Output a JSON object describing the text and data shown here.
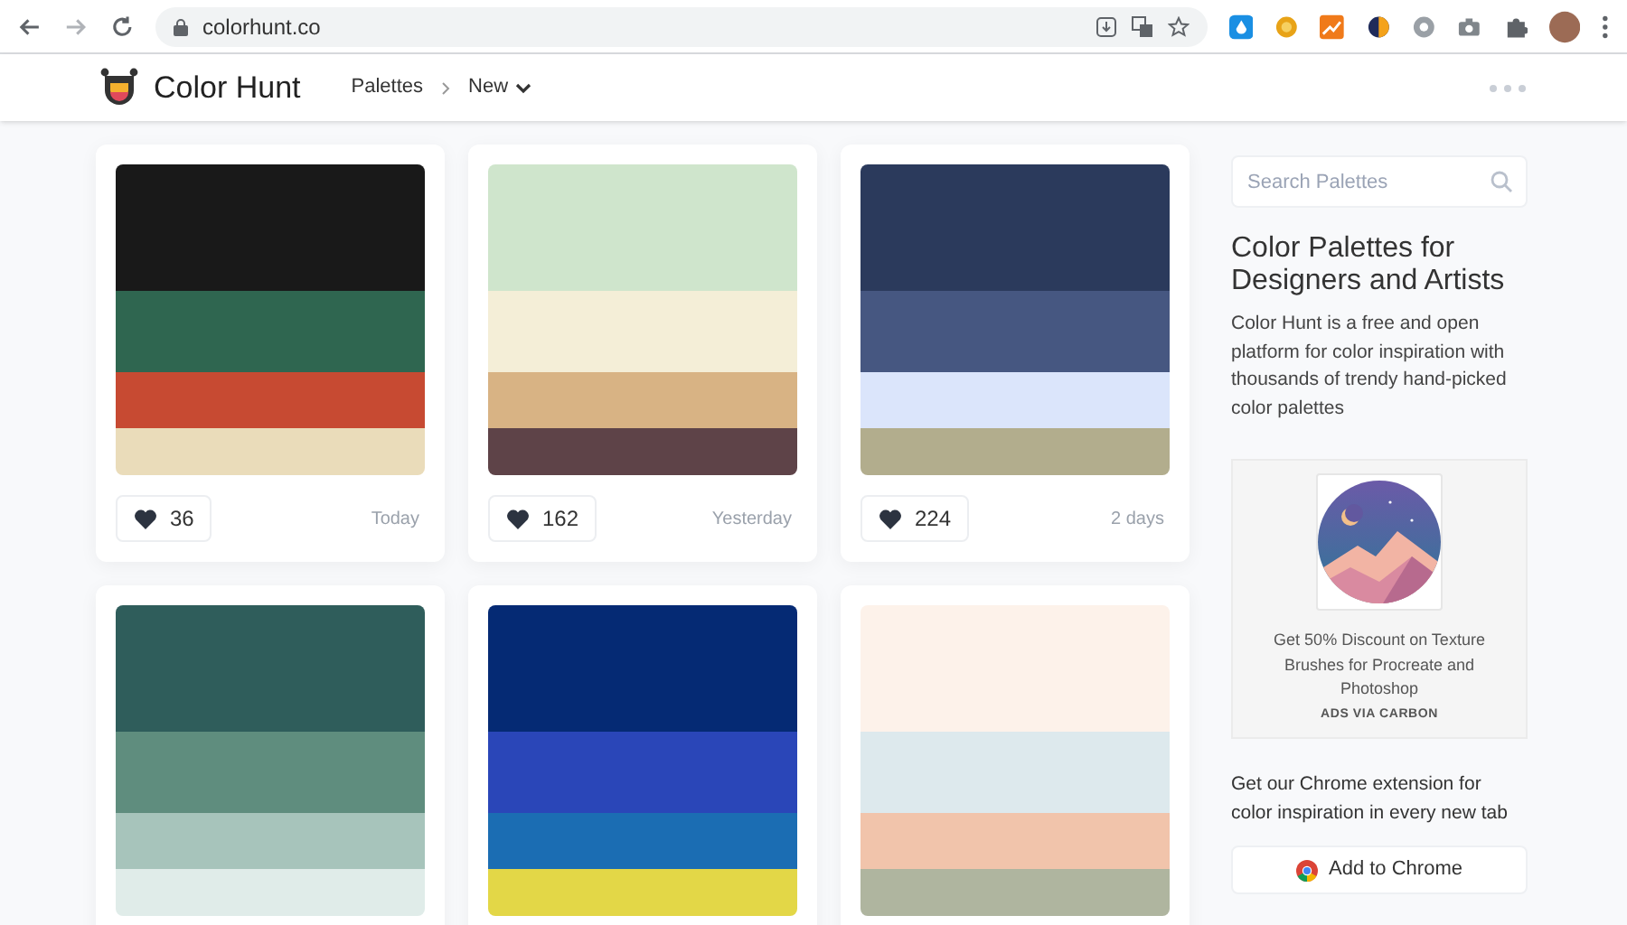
{
  "browser": {
    "url": "colorhunt.co"
  },
  "site": {
    "name": "Color Hunt",
    "nav": [
      {
        "label": "Palettes",
        "kind": "link"
      },
      {
        "label": "New",
        "kind": "dropdown"
      }
    ]
  },
  "palettes": [
    {
      "swatches": [
        {
          "color": "#191919"
        },
        {
          "color": "#2f6650"
        },
        {
          "color": "#c74a32"
        },
        {
          "color": "#eadcba"
        }
      ],
      "likes": "36",
      "time": "Today"
    },
    {
      "swatches": [
        {
          "color": "#cfe5cc"
        },
        {
          "color": "#f4eed7"
        },
        {
          "color": "#d8b384"
        },
        {
          "color": "#5e4348"
        }
      ],
      "likes": "162",
      "time": "Yesterday"
    },
    {
      "swatches": [
        {
          "color": "#2b3a5c"
        },
        {
          "color": "#465781"
        },
        {
          "color": "#dbe5fb"
        },
        {
          "color": "#b2ad8d"
        }
      ],
      "likes": "224",
      "time": "2 days"
    },
    {
      "swatches": [
        {
          "color": "#2f5d5b"
        },
        {
          "color": "#5f8d7e"
        },
        {
          "color": "#a7c4bb"
        },
        {
          "color": "#e0ece9"
        }
      ]
    },
    {
      "swatches": [
        {
          "color": "#052a74"
        },
        {
          "color": "#2a46b8"
        },
        {
          "color": "#1b6db3"
        },
        {
          "color": "#e3d747"
        }
      ]
    },
    {
      "swatches": [
        {
          "color": "#fdf2ea"
        },
        {
          "color": "#dde9ed"
        },
        {
          "color": "#f1c4ab"
        },
        {
          "color": "#afb59f"
        }
      ]
    }
  ],
  "sidebar": {
    "search_placeholder": "Search Palettes",
    "title": "Color Palettes for Designers and Artists",
    "description": "Color Hunt is a free and open platform for color inspiration with thousands of trendy hand-picked color palettes",
    "ad": {
      "kind": "picture",
      "text": "Get 50% Discount on Texture Brushes for Procreate and Photoshop",
      "via": "ADS VIA CARBON"
    },
    "extension_text": "Get our Chrome extension for color inspiration in every new tab",
    "button": "Add to Chrome"
  }
}
